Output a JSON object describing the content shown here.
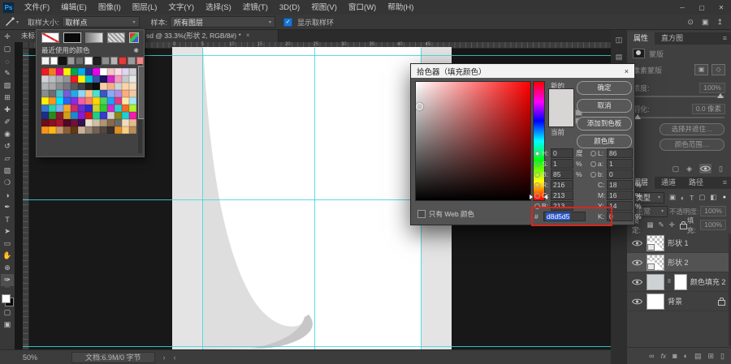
{
  "colors": {
    "accent_blue": "#1c76d1",
    "guide_cyan": "#3fd6de",
    "annotation_red": "#da251c",
    "picked_color": "#d8d5d5"
  },
  "menu_bar": {
    "logo": "Ps",
    "items": [
      "文件(F)",
      "编辑(E)",
      "图像(I)",
      "图层(L)",
      "文字(Y)",
      "选择(S)",
      "滤镜(T)",
      "3D(D)",
      "视图(V)",
      "窗口(W)",
      "帮助(H)"
    ],
    "window_controls": [
      {
        "name": "minimize-button",
        "glyph": "─"
      },
      {
        "name": "maximize-button",
        "glyph": "▢"
      },
      {
        "name": "close-button",
        "glyph": "✕"
      }
    ]
  },
  "options_bar": {
    "sample_size_label": "取样大小:",
    "sample_size_value": "取样点",
    "sample_label": "样本:",
    "sample_value": "所有图层",
    "show_ring_checked": "✓",
    "show_ring_label": "显示取样环",
    "right_icons": [
      {
        "name": "search-icon",
        "glyph": "⊙"
      },
      {
        "name": "workspace-icon",
        "glyph": "▣"
      },
      {
        "name": "share-icon",
        "glyph": "↥"
      }
    ]
  },
  "toolbar": {
    "tools": [
      {
        "name": "move-tool",
        "glyph": "✛"
      },
      {
        "name": "marquee-tool",
        "glyph": "▢"
      },
      {
        "name": "lasso-tool",
        "glyph": "◌"
      },
      {
        "name": "quick-selection-tool",
        "glyph": "✎"
      },
      {
        "name": "crop-tool",
        "glyph": "▧"
      },
      {
        "name": "frame-tool",
        "glyph": "⊞"
      },
      {
        "name": "healing-brush-tool",
        "glyph": "✚"
      },
      {
        "name": "brush-tool",
        "glyph": "✐"
      },
      {
        "name": "clone-stamp-tool",
        "glyph": "◉"
      },
      {
        "name": "history-brush-tool",
        "glyph": "↺"
      },
      {
        "name": "eraser-tool",
        "glyph": "▱"
      },
      {
        "name": "gradient-tool",
        "glyph": "▨"
      },
      {
        "name": "blur-tool",
        "glyph": "❍"
      },
      {
        "name": "dodge-tool",
        "glyph": "◑"
      },
      {
        "name": "pen-tool",
        "glyph": "✒"
      },
      {
        "name": "type-tool",
        "glyph": "T"
      },
      {
        "name": "path-selection-tool",
        "glyph": "➤"
      },
      {
        "name": "shape-tool",
        "glyph": "▭"
      },
      {
        "name": "hand-tool",
        "glyph": "✋"
      },
      {
        "name": "zoom-tool",
        "glyph": "⊕"
      },
      {
        "name": "eyedropper-tool",
        "glyph": "✑",
        "selected": true
      }
    ],
    "more_dots": "⋯",
    "quick-mask": "▢",
    "screen-mode": "▣"
  },
  "document": {
    "tab_hidden": "未标",
    "tab_title": "sd @ 33.3%(形状 2, RGB/8#) *",
    "tab_close": "×",
    "ruler_labels": [
      "0",
      "5",
      "10",
      "15",
      "20",
      "25",
      "30",
      "35",
      "40",
      "45"
    ],
    "zoom": "50%",
    "status": "文档:6.9M/0 字节",
    "status_arrows": [
      "›",
      "‹"
    ]
  },
  "swatches_panel": {
    "title": "最近使用的颜色",
    "gear": "✱",
    "recent": [
      "#f2f2f2",
      "#ffffff",
      "#141414",
      "#9b9b9b",
      "#6f6f6f",
      "#ffffff",
      "#1f1f1f",
      "#8e8e8e",
      "#b4b4b4",
      "#e13b3b",
      "#9b9b9b",
      "#ef8585",
      "#8e8e8e",
      "#3c3c3c"
    ],
    "grid": [
      [
        "#ee1c25",
        "#f47b20",
        "#ec008c",
        "#fff200",
        "#00a651",
        "#00aeef",
        "#2e3192",
        "#ec00ec",
        "#ffffff",
        "#f5c8c8",
        "#fadce6",
        "#e3d3f2",
        "#d1d3d4"
      ],
      [
        "#d1d3d4",
        "#bcbec0",
        "#a7a9ac",
        "#939598",
        "#ed1c24",
        "#fff200",
        "#00c5cd",
        "#3953a4",
        "#1b1464",
        "#d328c8",
        "#f49ac1",
        "#c7c8ca",
        "#e6e7e8"
      ],
      [
        "#b1b3b6",
        "#a7a9ac",
        "#8a8c8e",
        "#77787b",
        "#58595b",
        "#414042",
        "#231f20",
        "#0d0d0d",
        "#f7cfa4",
        "#f2b189",
        "#d1d3d4",
        "#fcd5a5",
        "#f5dfc0"
      ],
      [
        "#8a8c8e",
        "#6d6e71",
        "#4fc1cb",
        "#7a5cd6",
        "#27aae1",
        "#8ed8f8",
        "#fdc689",
        "#4ce0cf",
        "#3a56c4",
        "#8da9f5",
        "#b08fe0",
        "#f9ad81",
        "#f1c9a5"
      ],
      [
        "#fff200",
        "#f7941d",
        "#00e5ff",
        "#2b65f0",
        "#8b2be2",
        "#f05fa8",
        "#f58466",
        "#ffd400",
        "#54d159",
        "#1ba2f5",
        "#e03a87",
        "#fbe8a6",
        "#a6e6fb"
      ],
      [
        "#3a77d1",
        "#2bd1ab",
        "#7ab0f5",
        "#f5a72b",
        "#d12b68",
        "#6a2bd1",
        "#2b2bd1",
        "#d1d12b",
        "#2bd12b",
        "#d12bd1",
        "#2bd1d1",
        "#f56a2b",
        "#aef52b"
      ],
      [
        "#1b2f8a",
        "#2b8a1b",
        "#8a1b2f",
        "#d1a01b",
        "#1b8ad1",
        "#8a1bd1",
        "#d11b1b",
        "#1bd18a",
        "#3a3ad1",
        "#d1d1d1",
        "#8a8a1b",
        "#1bd1d1",
        "#f51bab"
      ],
      [
        "#6b0f1a",
        "#8a1025",
        "#a3152e",
        "#4d0a26",
        "#731038",
        "#36104a",
        "#e8e0d0",
        "#cfc0a6",
        "#ad9673",
        "#8a6a48",
        "#6b6b6b",
        "#f2d9bf",
        "#e6b98e"
      ],
      [
        "#f7941d",
        "#fdb913",
        "#c49a6c",
        "#8b5e3c",
        "#603913",
        "#c7b299",
        "#998675",
        "#736357",
        "#534741",
        "#362f2d",
        "#df9126",
        "#f7cf87",
        "#b78f5a"
      ]
    ]
  },
  "color_picker": {
    "title": "拾色器（填充颜色）",
    "close": "×",
    "new_label": "新的",
    "current_label": "当前",
    "buttons": [
      {
        "name": "ok-button",
        "label": "确定"
      },
      {
        "name": "cancel-button",
        "label": "取消"
      },
      {
        "name": "add-to-swatches-button",
        "label": "添加到色板"
      },
      {
        "name": "color-libraries-button",
        "label": "颜色库"
      }
    ],
    "value_rows": [
      {
        "left": {
          "radio": true,
          "selected": true,
          "label": "H:",
          "value": "0",
          "unit": "度"
        },
        "right": {
          "radio": true,
          "label": "L:",
          "value": "86",
          "unit": ""
        }
      },
      {
        "left": {
          "radio": true,
          "label": "S:",
          "value": "1",
          "unit": "%"
        },
        "right": {
          "radio": true,
          "label": "a:",
          "value": "1",
          "unit": ""
        }
      },
      {
        "left": {
          "radio": true,
          "label": "B:",
          "value": "85",
          "unit": "%"
        },
        "right": {
          "radio": true,
          "label": "b:",
          "value": "0",
          "unit": ""
        }
      },
      {
        "left": {
          "radio": true,
          "label": "R:",
          "value": "216",
          "unit": ""
        },
        "right": {
          "radio": false,
          "label": "C:",
          "value": "18",
          "unit": "%"
        }
      },
      {
        "left": {
          "radio": true,
          "label": "G:",
          "value": "213",
          "unit": ""
        },
        "right": {
          "radio": false,
          "label": "M:",
          "value": "16",
          "unit": "%"
        }
      },
      {
        "left": {
          "radio": true,
          "label": "B:",
          "value": "213",
          "unit": ""
        },
        "right": {
          "radio": false,
          "label": "Y:",
          "value": "14",
          "unit": "%"
        }
      },
      {
        "left": {
          "hex": true,
          "label": "#",
          "value": "d8d5d5"
        },
        "right": {
          "radio": false,
          "label": "K:",
          "value": "0",
          "unit": "%"
        }
      }
    ],
    "web_only_label": "只有 Web 颜色",
    "picked_hex": "d8d5d5"
  },
  "properties_panel": {
    "tabs": [
      "属性",
      "直方图"
    ],
    "menu": "≡",
    "header": "蒙版",
    "mask_label": "像素蒙版",
    "mask_buttons": [
      {
        "name": "add-pixel-mask-button",
        "glyph": "▣"
      },
      {
        "name": "add-vector-mask-button",
        "glyph": "◇"
      }
    ],
    "density_label": "浓度:",
    "density_value": "100%",
    "feather_label": "羽化:",
    "feather_value": "0.0 像素",
    "buttons": [
      "选择并遮住…",
      "颜色范围…"
    ],
    "bottom_icons": [
      {
        "name": "mask-load-selection-icon",
        "glyph": "▢"
      },
      {
        "name": "mask-apply-icon",
        "glyph": "◈"
      },
      {
        "name": "mask-visibility-icon",
        "glyph": "eye"
      },
      {
        "name": "delete-mask-icon",
        "glyph": "▯"
      }
    ]
  },
  "layers_panel": {
    "tabs": [
      "图层",
      "通道",
      "路径"
    ],
    "menu": "≡",
    "filter_label": "类型",
    "filter_dot": "●",
    "filter_icons": [
      {
        "name": "filter-pixel-layers-icon",
        "glyph": "▣"
      },
      {
        "name": "filter-adjustment-layers-icon",
        "glyph": "◐"
      },
      {
        "name": "filter-type-layers-icon",
        "glyph": "T"
      },
      {
        "name": "filter-shape-layers-icon",
        "glyph": "▢"
      },
      {
        "name": "filter-smart-objects-icon",
        "glyph": "◧"
      }
    ],
    "blend_mode": "正常",
    "opacity_label": "不透明度:",
    "opacity_value": "100%",
    "lock_label": "锁定:",
    "fill_label": "填充:",
    "fill_value": "100%",
    "lock_icons": [
      {
        "name": "lock-transparency-icon",
        "glyph": "▦"
      },
      {
        "name": "lock-pixels-icon",
        "glyph": "✎"
      },
      {
        "name": "lock-position-icon",
        "glyph": "✛"
      },
      {
        "name": "lock-all-icon",
        "glyph": "lock"
      }
    ],
    "layers": [
      {
        "name": "形状 1",
        "type": "shape"
      },
      {
        "name": "形状 2",
        "type": "shape",
        "selected": true
      },
      {
        "name": "颜色填充 2",
        "type": "fill",
        "link": "8"
      },
      {
        "name": "背景",
        "type": "background",
        "locked": true
      }
    ],
    "bottom_icons": [
      {
        "name": "link-layers-icon",
        "glyph": "∞"
      },
      {
        "name": "layer-effects-icon",
        "glyph": "fx"
      },
      {
        "name": "add-layer-mask-icon",
        "glyph": "◙"
      },
      {
        "name": "new-adjustment-layer-icon",
        "glyph": "◐"
      },
      {
        "name": "new-group-icon",
        "glyph": "▤"
      },
      {
        "name": "new-layer-icon",
        "glyph": "⊞"
      },
      {
        "name": "delete-layer-icon",
        "glyph": "▯"
      }
    ]
  },
  "edge_strip": {
    "icons": [
      {
        "name": "collapse-properties-icon",
        "glyph": "◫"
      },
      {
        "name": "collapse-panel-icon",
        "glyph": "▤"
      }
    ]
  }
}
